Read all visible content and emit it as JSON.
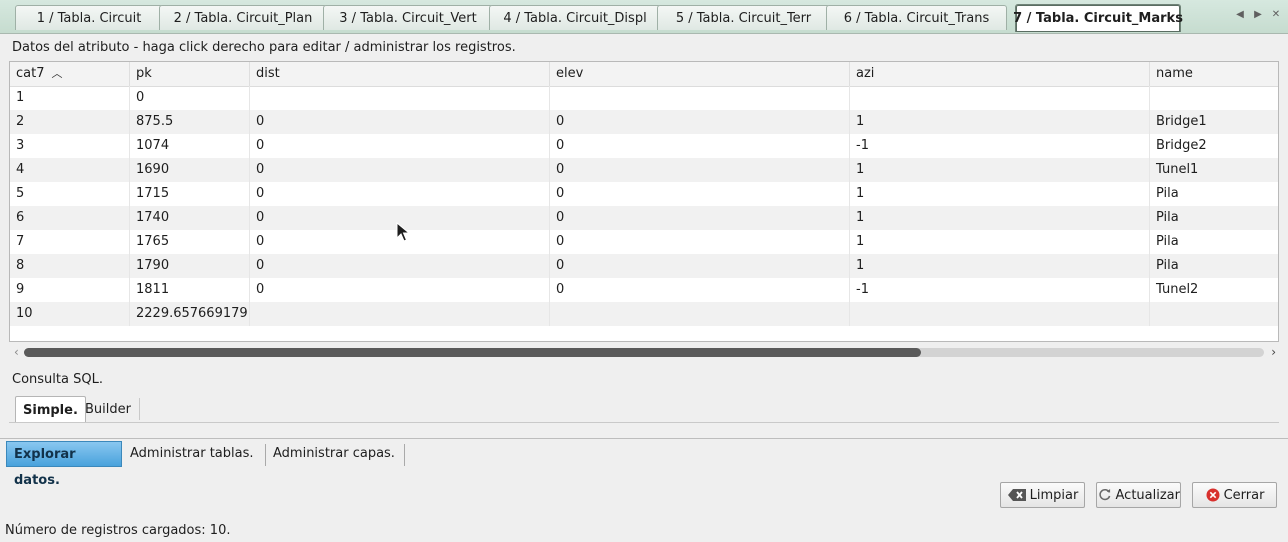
{
  "tabs": [
    {
      "label": "1 / Tabla. Circuit"
    },
    {
      "label": "2 / Tabla. Circuit_Plan"
    },
    {
      "label": "3 / Tabla. Circuit_Vert"
    },
    {
      "label": "4 / Tabla. Circuit_Displ"
    },
    {
      "label": "5 / Tabla. Circuit_Terr"
    },
    {
      "label": "6 / Tabla. Circuit_Trans"
    },
    {
      "label": "7 / Tabla. Circuit_Marks"
    }
  ],
  "attribute_label": "Datos del atributo - haga click derecho para editar / administrar los registros.",
  "table": {
    "sorted_column": "cat7",
    "columns": [
      "cat7",
      "pk",
      "dist",
      "elev",
      "azi",
      "name"
    ],
    "rows": [
      [
        "1",
        "0",
        "",
        "",
        "",
        ""
      ],
      [
        "2",
        "875.5",
        "0",
        "0",
        "1",
        "Bridge1"
      ],
      [
        "3",
        "1074",
        "0",
        "0",
        "-1",
        "Bridge2"
      ],
      [
        "4",
        "1690",
        "0",
        "0",
        "1",
        "Tunel1"
      ],
      [
        "5",
        "1715",
        "0",
        "0",
        "1",
        "Pila"
      ],
      [
        "6",
        "1740",
        "0",
        "0",
        "1",
        "Pila"
      ],
      [
        "7",
        "1765",
        "0",
        "0",
        "1",
        "Pila"
      ],
      [
        "8",
        "1790",
        "0",
        "0",
        "1",
        "Pila"
      ],
      [
        "9",
        "1811",
        "0",
        "0",
        "-1",
        "Tunel2"
      ],
      [
        "10",
        "2229.65766917916",
        "",
        "",
        "",
        ""
      ]
    ]
  },
  "sql": {
    "label": "Consulta SQL.",
    "tabs": [
      {
        "label": "Simple."
      },
      {
        "label": "Builder"
      }
    ]
  },
  "bottom_tabs": [
    {
      "label": "Explorar datos."
    },
    {
      "label": "Administrar tablas."
    },
    {
      "label": "Administrar capas."
    }
  ],
  "buttons": {
    "clear": "Limpiar",
    "refresh": "Actualizar",
    "close": "Cerrar"
  },
  "status_text": "Número de registros cargados: 10.",
  "colors": {
    "active_tab_accent": "#49a2dc",
    "close_icon": "#d8302d"
  }
}
